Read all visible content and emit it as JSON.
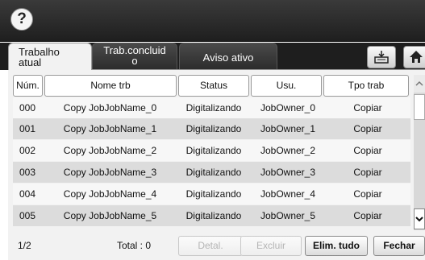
{
  "help": {
    "label": "?"
  },
  "tabs": [
    {
      "label": "Trabalho atual",
      "line1": "Trabalho",
      "line2": "atual"
    },
    {
      "label": "Trab.concluído",
      "line1": "Trab.concluid",
      "line2": "o"
    },
    {
      "label": "Aviso ativo"
    }
  ],
  "icons": {
    "tray": "tray-icon",
    "home": "home-icon"
  },
  "table": {
    "headers": [
      "Núm.",
      "Nome trb",
      "Status",
      "Usu.",
      "Tpo trab"
    ],
    "rows": [
      {
        "num": "000",
        "name": "Copy JobJobName_0",
        "status": "Digitalizando",
        "user": "JobOwner_0",
        "type": "Copiar"
      },
      {
        "num": "001",
        "name": "Copy JobJobName_1",
        "status": "Digitalizando",
        "user": "JobOwner_1",
        "type": "Copiar"
      },
      {
        "num": "002",
        "name": "Copy JobJobName_2",
        "status": "Digitalizando",
        "user": "JobOwner_2",
        "type": "Copiar"
      },
      {
        "num": "003",
        "name": "Copy JobJobName_3",
        "status": "Digitalizando",
        "user": "JobOwner_3",
        "type": "Copiar"
      },
      {
        "num": "004",
        "name": "Copy JobJobName_4",
        "status": "Digitalizando",
        "user": "JobOwner_4",
        "type": "Copiar"
      },
      {
        "num": "005",
        "name": "Copy JobJobName_5",
        "status": "Digitalizando",
        "user": "JobOwner_5",
        "type": "Copiar"
      }
    ]
  },
  "footer": {
    "page": "1/2",
    "total": "Total : 0",
    "detail": "Detal.",
    "delete": "Excluir",
    "delete_all": "Elim. tudo",
    "close": "Fechar"
  }
}
